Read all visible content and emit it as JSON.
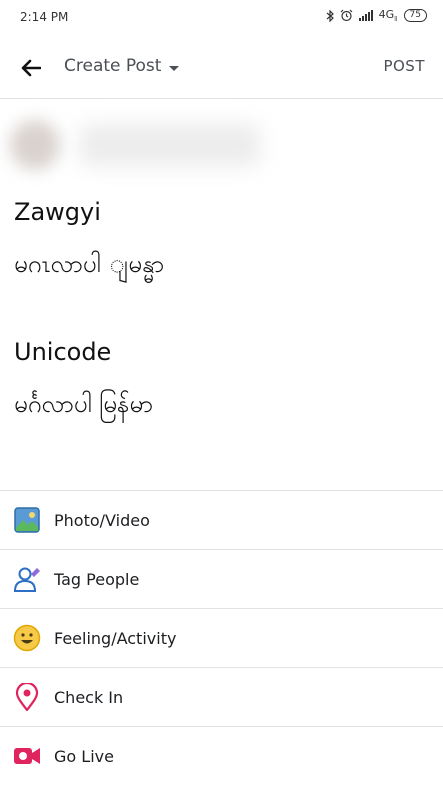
{
  "status_bar": {
    "time": "2:14 PM",
    "network": "4G",
    "network_sub": "ll",
    "battery": "75"
  },
  "header": {
    "title": "Create Post",
    "post_button": "POST"
  },
  "post": {
    "line1": "Zawgyi",
    "line2": "မဂၤလာပါ ျမန္မာ",
    "line3": "Unicode",
    "line4": "မင်္ဂလာပါ မြန်မာ"
  },
  "actions": [
    {
      "label": "Photo/Video",
      "icon": "photo-icon"
    },
    {
      "label": "Tag People",
      "icon": "tag-people-icon"
    },
    {
      "label": "Feeling/Activity",
      "icon": "smiley-icon"
    },
    {
      "label": "Check In",
      "icon": "location-pin-icon"
    },
    {
      "label": "Go Live",
      "icon": "video-camera-icon"
    }
  ]
}
